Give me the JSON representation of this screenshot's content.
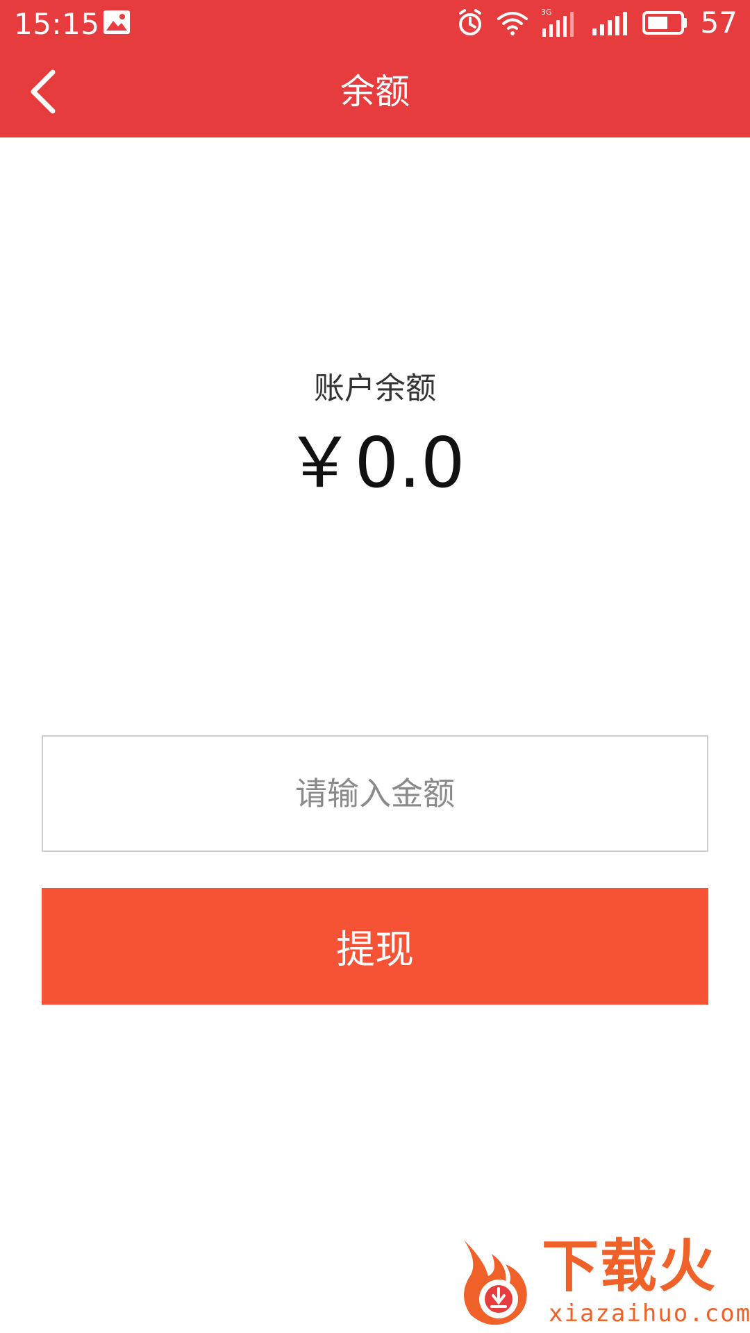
{
  "status_bar": {
    "time": "15:15",
    "battery_level": "57",
    "icons": [
      "image-notification-icon",
      "alarm-icon",
      "wifi-icon",
      "3g-signal-icon",
      "signal-icon",
      "battery-icon"
    ],
    "network_label": "3G"
  },
  "header": {
    "title": "余额",
    "back_icon": "chevron-left-icon",
    "background": "#E73C3E"
  },
  "balance": {
    "label": "账户余额",
    "amount": "￥0.0"
  },
  "withdraw": {
    "input_value": "",
    "input_placeholder": "请输入金额",
    "button_label": "提现",
    "button_color": "#F55236"
  },
  "watermark": {
    "brand": "下载火",
    "domain": "xiazaihuo.com",
    "color": "#F0612A"
  }
}
